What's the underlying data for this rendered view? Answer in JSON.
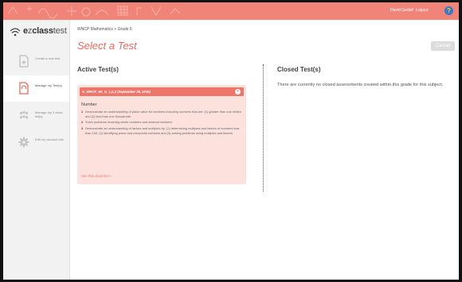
{
  "topbar": {
    "user_name": "David Gedall",
    "logout_label": "Logout",
    "help_label": "?"
  },
  "logo": {
    "brand_e": "e",
    "brand_z": "z",
    "brand_class": "class",
    "brand_test": "test"
  },
  "sidebar": {
    "items": [
      {
        "label": "Create a new test",
        "icon": "create-test-icon"
      },
      {
        "label": "Manage my Test(s)",
        "icon": "manage-tests-icon",
        "active": true
      },
      {
        "label": "Manage my 3 class list(s)",
        "icon": "class-list-icon"
      },
      {
        "label": "Edit my account info",
        "icon": "gear-icon"
      }
    ]
  },
  "main": {
    "breadcrumb": "WNCP Mathematics > Grade 6",
    "title": "Select a Test",
    "cancel_label": "Cancel",
    "active_heading": "Active Test(s)",
    "closed_heading": "Closed Test(s)",
    "closed_message": "There are currently no closed assessments created within this grade for this subject.",
    "card": {
      "name": "N_WNCP_6A_N_1,2,3",
      "date": "(September 26, 2016)",
      "subject": "Number",
      "standards": [
        {
          "n": "1",
          "text": "Demonstrate an understanding of place value for numbers including numbers that are: (1) greater than one million and (2) less than one thousandth."
        },
        {
          "n": "2",
          "text": "Solve problems involving whole numbers and decimal numbers."
        },
        {
          "n": "3",
          "text": "Demonstrate an understanding of factors and multiples by: (1) determining multiples and factors of numbers less than 100, (2) identifying prime and composite numbers and (3) solving problems using multiples and factors."
        }
      ],
      "link_label": "See this class list >"
    }
  },
  "colors": {
    "accent": "#ee756a",
    "topbar": "#f08478",
    "help": "#3a78c2"
  }
}
